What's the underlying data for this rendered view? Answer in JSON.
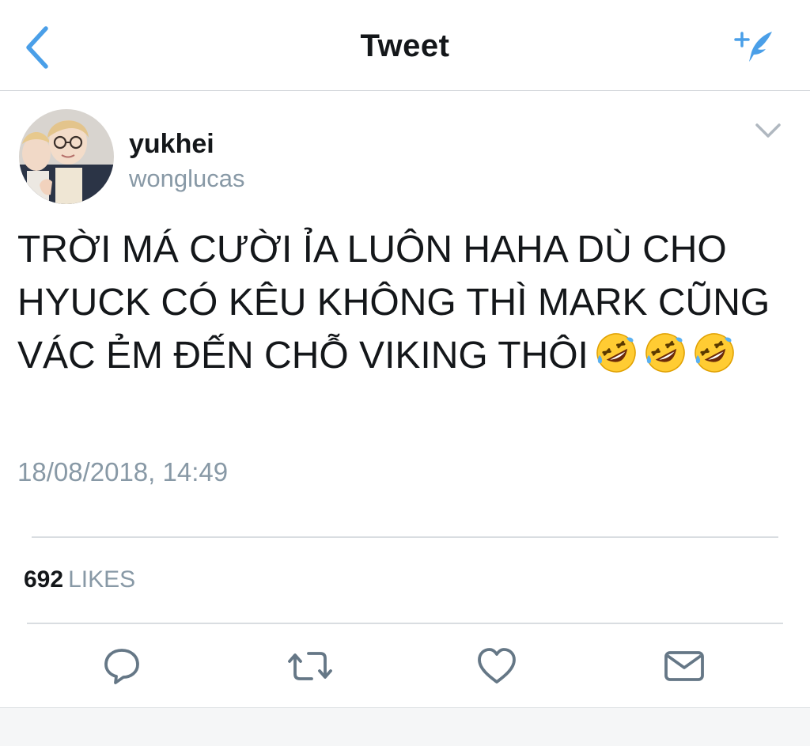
{
  "header": {
    "title": "Tweet",
    "back_icon": "chevron-left-icon",
    "compose_icon": "compose-tweet-icon",
    "accent_color": "#4a9fe8"
  },
  "tweet": {
    "author": {
      "display_name": "yukhei",
      "handle": "wonglucas"
    },
    "text": "TRỜI MÁ CƯỜI ỈA LUÔN HAHA DÙ CHO HYUCK CÓ KÊU KHÔNG THÌ MARK CŨNG VÁC ẺM ĐẾN CHỖ VIKING THÔI",
    "emoji": [
      "rolling-on-floor-laughing",
      "rolling-on-floor-laughing",
      "rolling-on-floor-laughing"
    ],
    "timestamp": "18/08/2018, 14:49",
    "likes": {
      "count": "692",
      "label": "LIKES"
    }
  },
  "actions": [
    {
      "name": "reply",
      "icon": "reply-icon"
    },
    {
      "name": "retweet",
      "icon": "retweet-icon"
    },
    {
      "name": "like",
      "icon": "heart-icon"
    },
    {
      "name": "direct-message",
      "icon": "envelope-icon"
    }
  ],
  "colors": {
    "text_primary": "#14171a",
    "text_secondary": "#8899a6",
    "icon_gray": "#657786"
  }
}
